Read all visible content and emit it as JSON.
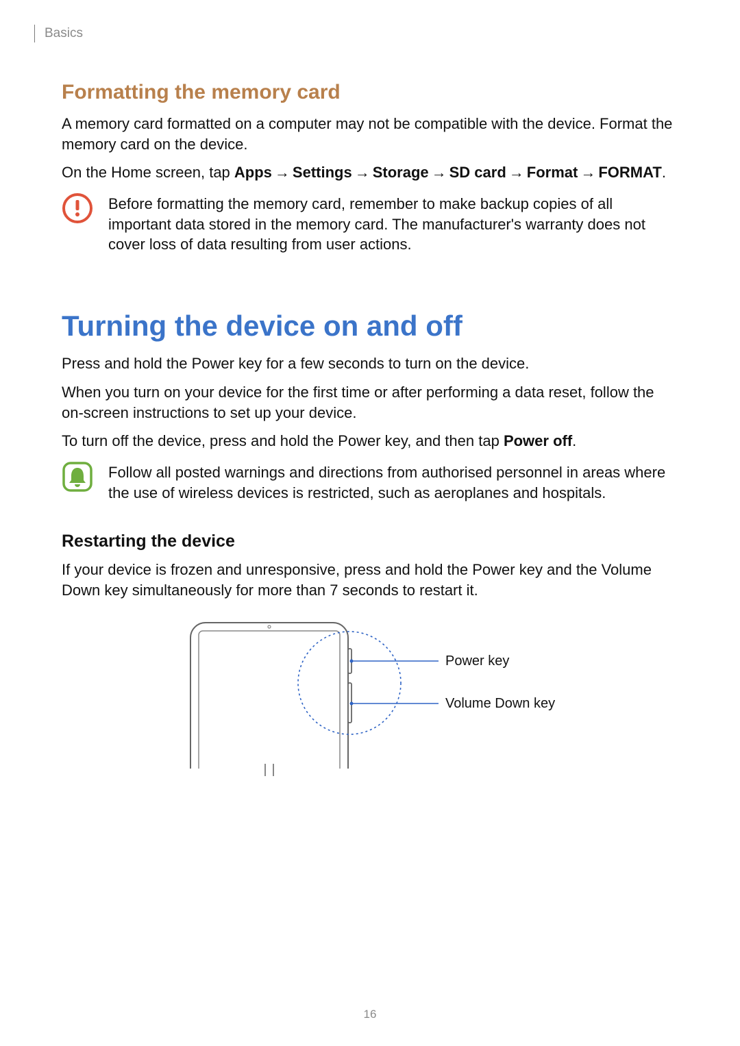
{
  "header": {
    "section": "Basics"
  },
  "format_card": {
    "title": "Formatting the memory card",
    "para": "A memory card formatted on a computer may not be compatible with the device. Format the memory card on the device.",
    "nav_prefix": "On the Home screen, tap ",
    "nav_steps": [
      "Apps",
      "Settings",
      "Storage",
      "SD card",
      "Format",
      "FORMAT"
    ],
    "nav_suffix": ".",
    "warning": "Before formatting the memory card, remember to make backup copies of all important data stored in the memory card. The manufacturer's warranty does not cover loss of data resulting from user actions."
  },
  "power": {
    "title": "Turning the device on and off",
    "para1": "Press and hold the Power key for a few seconds to turn on the device.",
    "para2": "When you turn on your device for the first time or after performing a data reset, follow the on-screen instructions to set up your device.",
    "para3_prefix": "To turn off the device, press and hold the Power key, and then tap ",
    "para3_bold": "Power off",
    "para3_suffix": ".",
    "notice": "Follow all posted warnings and directions from authorised personnel in areas where the use of wireless devices is restricted, such as aeroplanes and hospitals."
  },
  "restart": {
    "title": "Restarting the device",
    "para": "If your device is frozen and unresponsive, press and hold the Power key and the Volume Down key simultaneously for more than 7 seconds to restart it.",
    "label_power": "Power key",
    "label_volume": "Volume Down key"
  },
  "page_number": "16"
}
